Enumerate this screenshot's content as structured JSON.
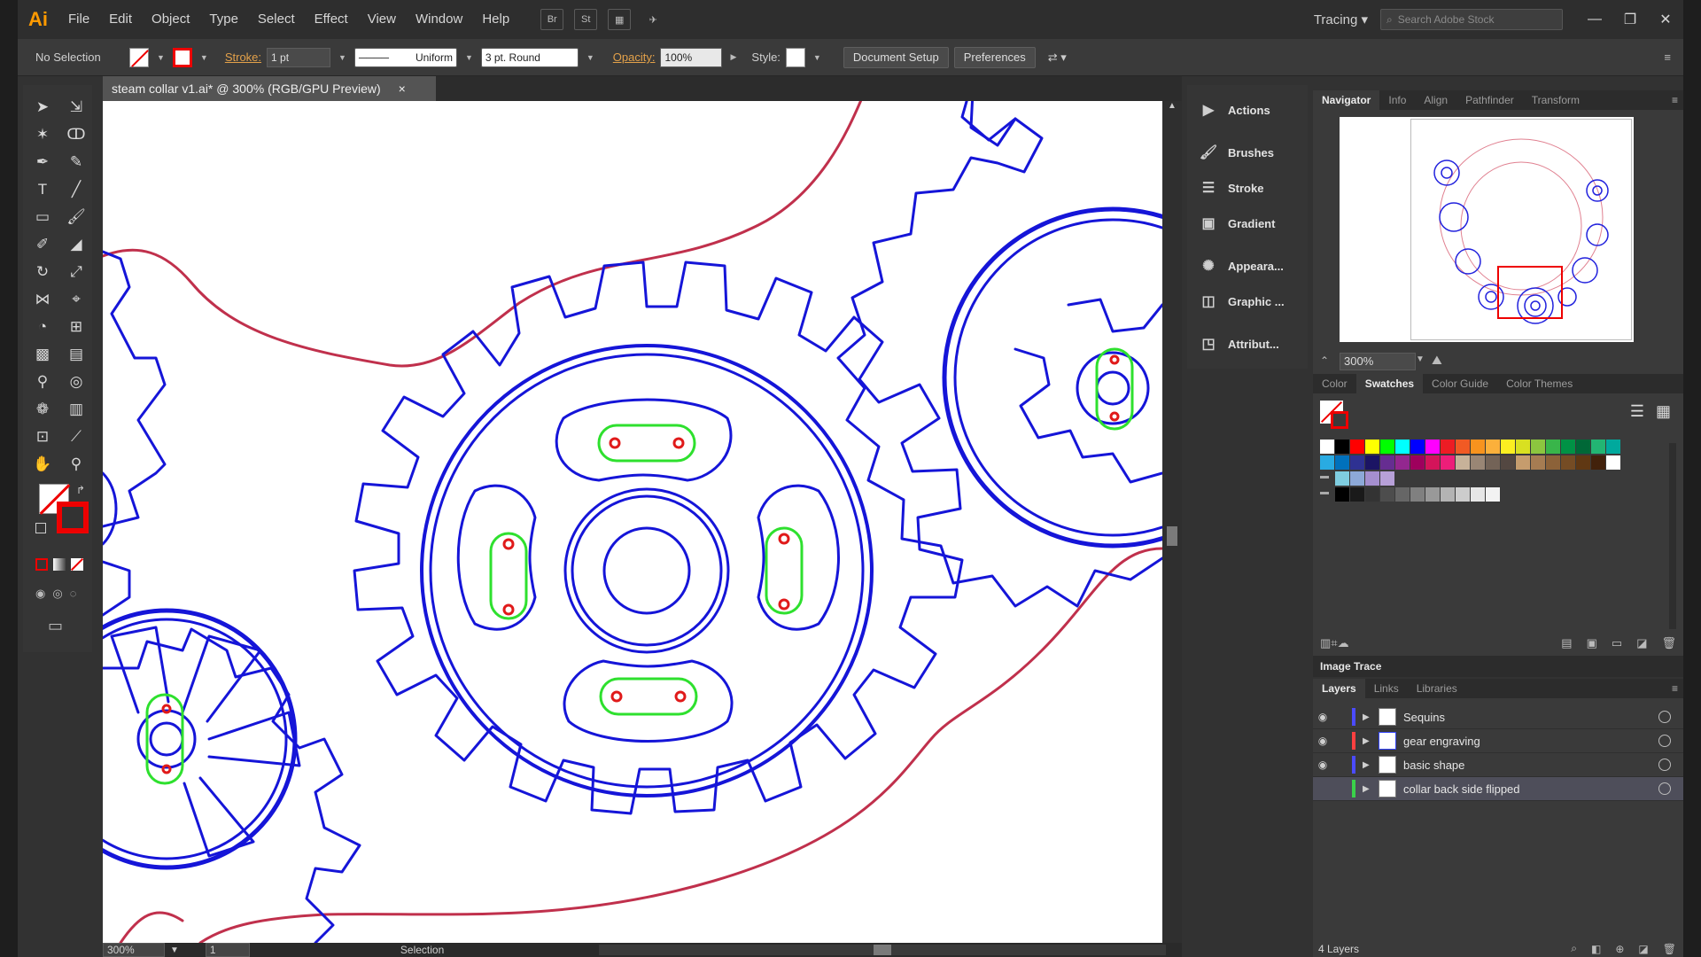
{
  "app": {
    "logo": "Ai",
    "workspace": "Tracing",
    "search_placeholder": "Search Adobe Stock"
  },
  "menu": [
    "File",
    "Edit",
    "Object",
    "Type",
    "Select",
    "Effect",
    "View",
    "Window",
    "Help"
  ],
  "menu_icons": {
    "bridge": "Br",
    "stock": "St"
  },
  "control": {
    "selection": "No Selection",
    "stroke_label": "Stroke:",
    "stroke_weight": "1 pt",
    "profile": "Uniform",
    "brush": "3 pt. Round",
    "opacity_label": "Opacity:",
    "opacity_value": "100%",
    "style_label": "Style:",
    "doc_setup": "Document Setup",
    "preferences": "Preferences"
  },
  "document": {
    "tab_title": "steam collar v1.ai* @ 300% (RGB/GPU Preview)",
    "close": "×"
  },
  "status": {
    "zoom": "300%",
    "artboard": "1",
    "tool": "Selection"
  },
  "icon_panels": [
    "Actions",
    "Brushes",
    "Stroke",
    "Gradient",
    "Appeara...",
    "Graphic ...",
    "Attribut..."
  ],
  "navigator": {
    "tabs": [
      "Navigator",
      "Info",
      "Align",
      "Pathfinder",
      "Transform"
    ],
    "zoom": "300%"
  },
  "swatches": {
    "tabs": [
      "Color",
      "Swatches",
      "Color Guide",
      "Color Themes"
    ],
    "row1": [
      "#ffffff",
      "#000000",
      "#ff0000",
      "#ffff00",
      "#00ff00",
      "#00ffff",
      "#0000ff",
      "#ff00ff",
      "#ed1c24",
      "#f15a24",
      "#f7931e",
      "#fbb03b",
      "#fcee21",
      "#d9e021",
      "#8cc63f",
      "#39b54a",
      "#009245",
      "#006837",
      "#22b573",
      "#00a99d"
    ],
    "row2": [
      "#29abe2",
      "#0071bc",
      "#2e3192",
      "#1b1464",
      "#662d91",
      "#93278f",
      "#9e005d",
      "#d4145a",
      "#ed1e79",
      "#c7b299",
      "#998675",
      "#736357",
      "#534741",
      "#c69c6d",
      "#a67c52",
      "#8c6239",
      "#754c24",
      "#603813",
      "#42210b",
      "#ffffff"
    ],
    "row3": [
      "#7fcde0",
      "#8da9d8",
      "#a58fcf",
      "#b7a0d8"
    ],
    "row4": [
      "#000000",
      "#1a1a1a",
      "#333333",
      "#4d4d4d",
      "#666666",
      "#808080",
      "#999999",
      "#b3b3b3",
      "#cccccc",
      "#e6e6e6",
      "#f2f2f2"
    ]
  },
  "image_trace": {
    "title": "Image Trace"
  },
  "layers": {
    "tabs": [
      "Layers",
      "Links",
      "Libraries"
    ],
    "items": [
      {
        "name": "Sequins",
        "color": "#4b4bff",
        "visible": true,
        "selected": false
      },
      {
        "name": "gear engraving",
        "color": "#ff4040",
        "visible": true,
        "selected": false
      },
      {
        "name": "basic shape",
        "color": "#4b4bff",
        "visible": true,
        "selected": false
      },
      {
        "name": "collar back side flipped",
        "color": "#3ad24a",
        "visible": false,
        "selected": true
      }
    ],
    "count": "4 Layers"
  },
  "colors": {
    "accent_orange": "#ff9a00",
    "gear_blue": "#1515d8",
    "red_outline": "#c0304c",
    "green_slot": "#2ee02e"
  }
}
